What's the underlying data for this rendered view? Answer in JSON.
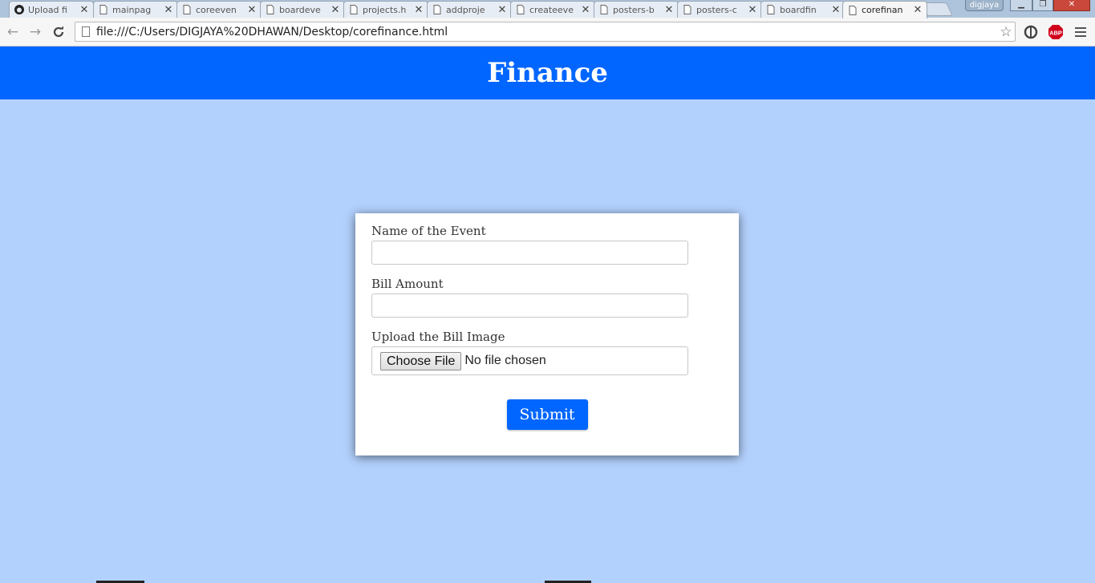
{
  "browser": {
    "tabs": [
      {
        "title": "Upload fi",
        "icon": "github-icon",
        "active": false
      },
      {
        "title": "mainpag",
        "icon": "page-icon",
        "active": false
      },
      {
        "title": "coreeven",
        "icon": "page-icon",
        "active": false
      },
      {
        "title": "boardeve",
        "icon": "page-icon",
        "active": false
      },
      {
        "title": "projects.h",
        "icon": "page-icon",
        "active": false
      },
      {
        "title": "addproje",
        "icon": "page-icon",
        "active": false
      },
      {
        "title": "createeve",
        "icon": "page-icon",
        "active": false
      },
      {
        "title": "posters-b",
        "icon": "page-icon",
        "active": false
      },
      {
        "title": "posters-c",
        "icon": "page-icon",
        "active": false
      },
      {
        "title": "boardfin",
        "icon": "page-icon",
        "active": false
      },
      {
        "title": "corefinan",
        "icon": "page-icon",
        "active": true
      }
    ],
    "close_glyph": "✕",
    "user_badge": "digjaya",
    "url": "file:///C:/Users/DIGJAYA%20DHAWAN/Desktop/corefinance.html",
    "abp_label": "ABP"
  },
  "header": {
    "title": "Finance",
    "color": "#0066ff"
  },
  "form": {
    "event_label": "Name of the Event",
    "event_value": "",
    "amount_label": "Bill Amount",
    "amount_value": "",
    "image_label": "Upload the Bill Image",
    "file_button": "Choose File",
    "file_status": "No file chosen",
    "submit_label": "Submit"
  },
  "colors": {
    "page_background": "#b3d1fd",
    "accent": "#0066ff"
  }
}
